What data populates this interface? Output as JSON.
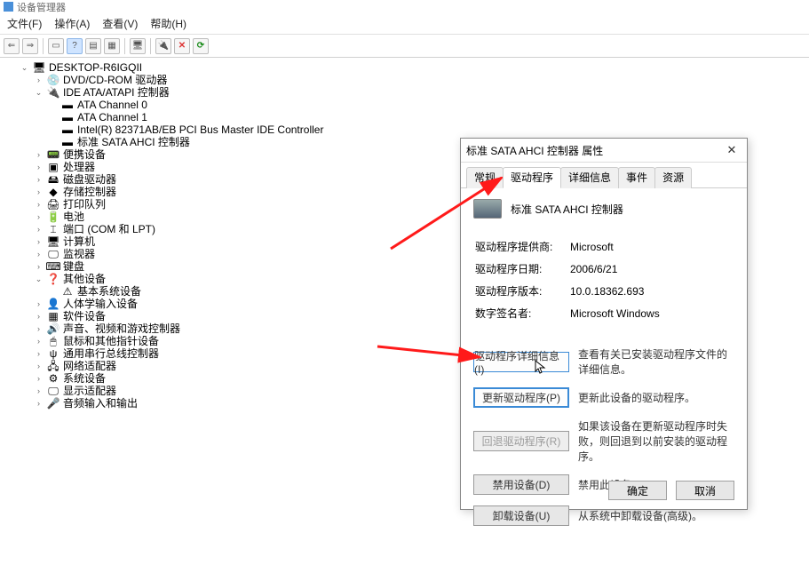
{
  "window": {
    "title": "设备管理器"
  },
  "menu": {
    "file": "文件(F)",
    "action": "操作(A)",
    "view": "查看(V)",
    "help": "帮助(H)"
  },
  "tree": {
    "root": "DESKTOP-R6IGQII",
    "dvd": "DVD/CD-ROM 驱动器",
    "ide": "IDE ATA/ATAPI 控制器",
    "ata0": "ATA Channel 0",
    "ata1": "ATA Channel 1",
    "intel": "Intel(R) 82371AB/EB PCI Bus Master IDE Controller",
    "sata": "标准 SATA AHCI 控制器",
    "portable": "便携设备",
    "cpu": "处理器",
    "disk": "磁盘驱动器",
    "storage": "存储控制器",
    "printq": "打印队列",
    "battery": "电池",
    "ports": "端口 (COM 和 LPT)",
    "computer": "计算机",
    "monitor": "监视器",
    "keyboard": "键盘",
    "other": "其他设备",
    "basesys": "基本系统设备",
    "hid": "人体学输入设备",
    "software": "软件设备",
    "sound": "声音、视频和游戏控制器",
    "mouse": "鼠标和其他指针设备",
    "usb": "通用串行总线控制器",
    "network": "网络适配器",
    "sysdev": "系统设备",
    "display": "显示适配器",
    "audio": "音频输入和输出"
  },
  "dialog": {
    "title": "标准 SATA AHCI 控制器 属性",
    "tabs": {
      "general": "常规",
      "driver": "驱动程序",
      "details": "详细信息",
      "events": "事件",
      "resources": "资源"
    },
    "device": "标准 SATA AHCI 控制器",
    "labels": {
      "provider": "驱动程序提供商:",
      "date": "驱动程序日期:",
      "version": "驱动程序版本:",
      "signer": "数字签名者:"
    },
    "values": {
      "provider": "Microsoft",
      "date": "2006/6/21",
      "version": "10.0.18362.693",
      "signer": "Microsoft Windows"
    },
    "buttons": {
      "details": "驱动程序详细信息(I)",
      "update": "更新驱动程序(P)",
      "rollback": "回退驱动程序(R)",
      "disable": "禁用设备(D)",
      "uninstall": "卸载设备(U)",
      "ok": "确定",
      "cancel": "取消"
    },
    "desc": {
      "details": "查看有关已安装驱动程序文件的详细信息。",
      "update": "更新此设备的驱动程序。",
      "rollback": "如果该设备在更新驱动程序时失败，则回退到以前安装的驱动程序。",
      "disable": "禁用此设备。",
      "uninstall": "从系统中卸载设备(高级)。"
    }
  }
}
